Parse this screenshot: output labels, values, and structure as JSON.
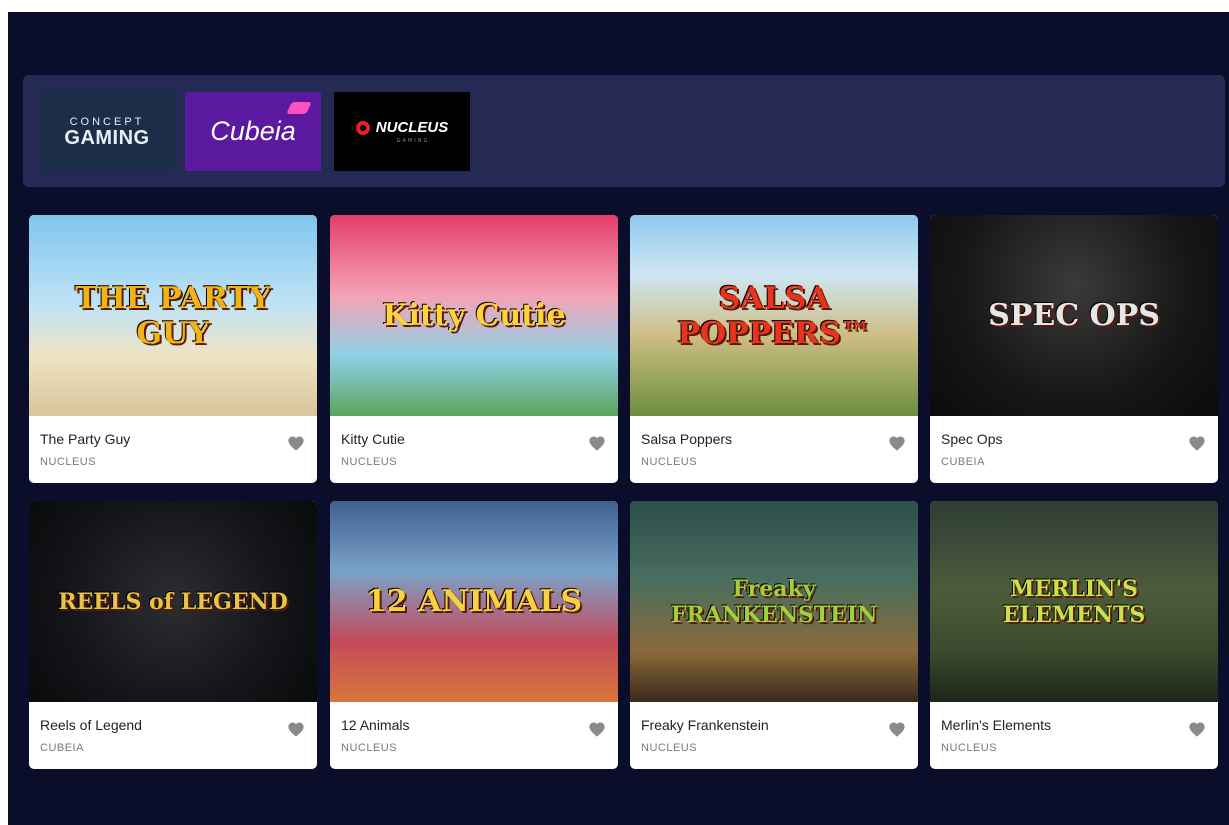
{
  "providers": [
    {
      "name": "concept-gaming",
      "line1": "CONCEPT",
      "line2": "GAMING"
    },
    {
      "name": "cubeia",
      "label": "Cubeia"
    },
    {
      "name": "nucleus",
      "label": "NUCLEUS",
      "sub": "GAMING"
    }
  ],
  "games": [
    {
      "title": "The Party Guy",
      "provider": "NUCLEUS",
      "art": "THE PARTY GUY",
      "bg": "linear-gradient(180deg,#7fc4ee 0%,#bfe3f5 45%,#efe3c4 70%,#d9c49b 100%)",
      "art_color": "#f0b318"
    },
    {
      "title": "Kitty Cutie",
      "provider": "NUCLEUS",
      "art": "Kitty Cutie",
      "bg": "linear-gradient(180deg,#e33e6b 0%,#f4a3b6 40%,#8fd0e6 70%,#5aa55c 100%)",
      "art_color": "#ffd23b"
    },
    {
      "title": "Salsa Poppers",
      "provider": "NUCLEUS",
      "art": "SALSA POPPERS™",
      "bg": "linear-gradient(180deg,#8ec9ef 0%,#cfe6f2 30%,#cdbd84 60%,#6d8f3c 100%)",
      "art_color": "#e8341c"
    },
    {
      "title": "Spec Ops",
      "provider": "CUBEIA",
      "art": "SPEC OPS",
      "bg": "radial-gradient(circle at 50% 35%,#3a3a3a 0%,#161616 60%,#0b0b0b 100%)",
      "art_color": "#e6e6e6"
    },
    {
      "title": "Reels of Legend",
      "provider": "CUBEIA",
      "art": "REELS of LEGEND",
      "bg": "radial-gradient(circle at 50% 50%,#2c2d30 0%,#141518 60%,#090a0c 100%)",
      "art_color": "#e7c34a"
    },
    {
      "title": "12 Animals",
      "provider": "NUCLEUS",
      "art": "12 ANIMALS",
      "bg": "linear-gradient(180deg,#3f5f8f 0%,#7aa2c9 35%,#c44a5a 70%,#d9763b 100%)",
      "art_color": "#f6d23f"
    },
    {
      "title": "Freaky Frankenstein",
      "provider": "NUCLEUS",
      "art": "Freaky FRANKENSTEIN",
      "bg": "linear-gradient(180deg,#2b4f4a 0%,#4a6e5e 40%,#8a6a3a 75%,#3b2a1a 100%)",
      "art_color": "#9ed03a"
    },
    {
      "title": "Merlin's Elements",
      "provider": "NUCLEUS",
      "art": "MERLIN'S ELEMENTS",
      "bg": "linear-gradient(180deg,#2d3d34 0%,#4d5b3a 45%,#3a4a2d 75%,#1c251b 100%)",
      "art_color": "#c9e24a"
    }
  ]
}
